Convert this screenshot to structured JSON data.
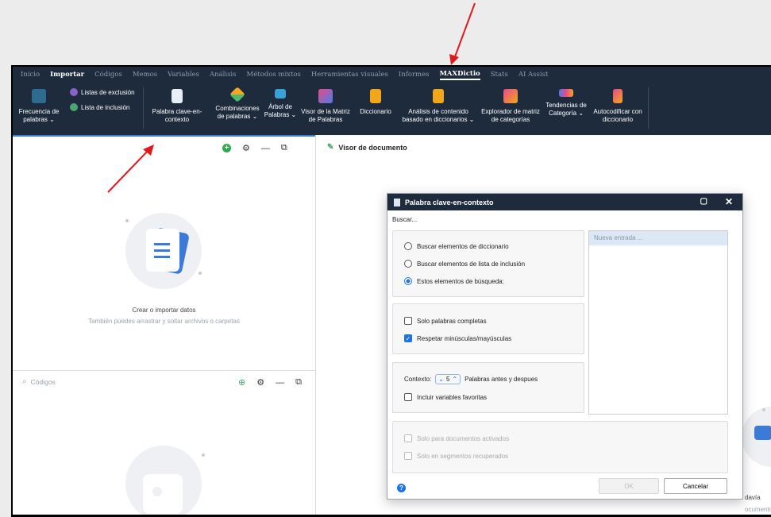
{
  "menu": [
    "Inicio",
    "Importar",
    "Códigos",
    "Memos",
    "Variables",
    "Análisis",
    "Métodos mixtos",
    "Herramientas visuales",
    "Informes",
    "MAXDictio",
    "Stats",
    "AI Assist"
  ],
  "menu_active": "MAXDictio",
  "ribbon": {
    "frecuencia": "Frecuencia de palabras ⌄",
    "listas_exclusion": "Listas de exclusión",
    "lista_inclusion": "Lista de inclusión",
    "palabra_clave": "Palabra clave-en-contexto",
    "combinaciones": "Combinaciones de palabras ⌄",
    "arbol": "Árbol de Palabras ⌄",
    "visor_matriz": "Visor de la Matriz de Palabras",
    "diccionario": "Diccionario",
    "analisis_contenido": "Análisis de contenido basado en diccionarios ⌄",
    "explorador": "Explorador de matriz de categorías",
    "tendencias": "Tendencias de Categoría ⌄",
    "autocodificar": "Autocodificar con diccionario"
  },
  "left_top": {
    "empty_title": "Crear o importar datos",
    "empty_sub": "También puedes arrastrar y soltar archivos o carpetas"
  },
  "left_bottom": {
    "search_placeholder": "Códigos"
  },
  "right": {
    "title": "Visor de documento",
    "partial1": "davía",
    "partial2": "ocumento"
  },
  "dialog": {
    "title": "Palabra clave-en-contexto",
    "buscar": "Buscar...",
    "radio1": "Buscar elementos de diccionario",
    "radio2": "Buscar elementos de lista de inclusión",
    "radio3": "Estos elementos de búsqueda:",
    "check1": "Solo palabras completas",
    "check2": "Respetar minúsculas/mayúsculas",
    "contexto_label": "Contexto:",
    "contexto_value": "5",
    "contexto_suffix": "Palabras antes y despues",
    "check3": "Incluir variables favoritas",
    "check4": "Solo para documentos activados",
    "check5": "Solo en segmentos recuperados",
    "entry_placeholder": "Nueva entrada ...",
    "ok": "OK",
    "cancel": "Cancelar"
  },
  "colors": {
    "dark": "#1e2b3c",
    "accent": "#1a73e8",
    "arrow": "#e3181d"
  }
}
